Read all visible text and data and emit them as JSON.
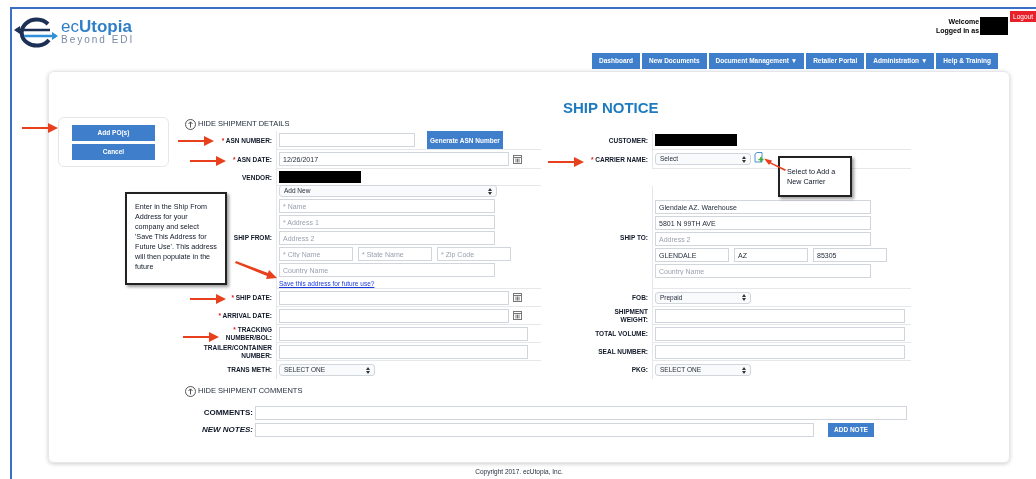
{
  "header": {
    "logo_name": "ec**Utopia**",
    "logo_tagline": "Beyond EDI",
    "welcome": "Welcome",
    "logged_in": "Logged in as",
    "logout": "Logout"
  },
  "nav": [
    {
      "label": "Dashboard"
    },
    {
      "label": "New Documents"
    },
    {
      "label": "Document Management ▼"
    },
    {
      "label": "Retailer Portal"
    },
    {
      "label": "Administration ▼"
    },
    {
      "label": "Help & Training"
    }
  ],
  "actions": [
    "Add PO(s)",
    "Cancel"
  ],
  "title": "SHIP NOTICE",
  "details_toggle": "HIDE SHIPMENT DETAILS",
  "form_rows": [
    {
      "left": {
        "marker": "*",
        "label": "ASN NUMBER:",
        "kind": "text",
        "button": "Generate ASN Number"
      },
      "right": {
        "label": "CUSTOMER:",
        "kind": "redacted"
      }
    },
    {
      "left": {
        "marker": "*",
        "label": "ASN DATE:",
        "kind": "date",
        "value": "12/26/2017"
      },
      "right": {
        "marker": "*",
        "label": "CARRIER NAME:",
        "kind": "select",
        "value": "Select",
        "add_icon": true
      }
    },
    {
      "left": {
        "label": "VENDOR:",
        "kind": "redacted"
      }
    },
    {
      "left": {
        "label": "SHIP FROM:",
        "kind": "address",
        "select": "Add New",
        "lines": [
          [
            {
              "placeholder": "* Name"
            }
          ],
          [
            {
              "placeholder": "* Address 1"
            }
          ],
          [
            {
              "placeholder": "Address 2"
            }
          ],
          [
            {
              "placeholder": "* City Name"
            },
            {
              "placeholder": "* State Name"
            },
            {
              "placeholder": "* Zip Code"
            }
          ],
          [
            {
              "placeholder": "Country Name"
            }
          ]
        ],
        "link": "Save this address for future use?"
      },
      "right": {
        "label": "SHIP TO:",
        "kind": "address",
        "lines": [
          [
            {
              "value": "Glendale AZ. Warehouse"
            }
          ],
          [
            {
              "value": "5801 N 99TH AVE"
            }
          ],
          [
            {
              "placeholder": "Address 2"
            }
          ],
          [
            {
              "value": "GLENDALE"
            },
            {
              "value": "AZ"
            },
            {
              "value": "85305"
            }
          ],
          [
            {
              "placeholder": "Country Name"
            }
          ]
        ]
      }
    },
    {
      "left": {
        "marker": "*",
        "label": "SHIP DATE:",
        "kind": "date"
      },
      "right": {
        "label": "FOB:",
        "kind": "select",
        "value": "Prepaid"
      }
    },
    {
      "left": {
        "marker": "*",
        "label": "ARRIVAL DATE:",
        "kind": "date"
      },
      "right": {
        "label": "SHIPMENT\nWEIGHT:",
        "kind": "text"
      }
    },
    {
      "left": {
        "marker": "*",
        "label": "TRACKING\nNUMBER/BOL:",
        "kind": "text"
      },
      "right": {
        "label": "TOTAL VOLUME:",
        "kind": "text"
      }
    },
    {
      "left": {
        "label": "TRAILER/CONTAINER\nNUMBER:",
        "kind": "text"
      },
      "right": {
        "label": "SEAL NUMBER:",
        "kind": "text"
      }
    },
    {
      "left": {
        "label": "TRANS METH:",
        "kind": "select",
        "value": "SELECT ONE"
      },
      "right": {
        "label": "PKG:",
        "kind": "select",
        "value": "SELECT ONE"
      }
    }
  ],
  "comments_toggle": "HIDE SHIPMENT COMMENTS",
  "comments": {
    "label": "COMMENTS:"
  },
  "notes": {
    "label": "NEW NOTES:",
    "button": "ADD NOTE"
  },
  "callouts": [
    {
      "text": "Enter in the Ship From Address for your company and select 'Save This Address for Future Use'. This address will then populate in the future"
    },
    {
      "text": "Select to Add a New Carrier"
    }
  ],
  "footer": "Copyright 2017. ecUtopia, Inc."
}
